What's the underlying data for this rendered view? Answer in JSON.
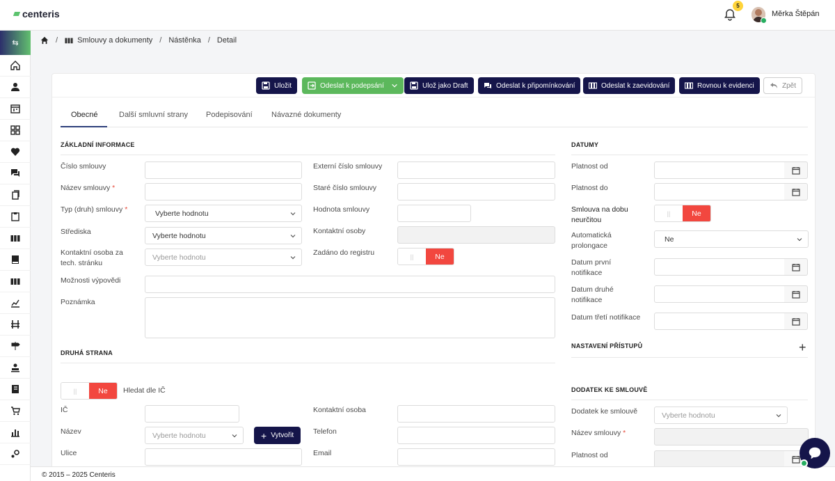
{
  "app": {
    "logo": "centeris",
    "notification_count": "5",
    "user_name": "Měrka Štěpán"
  },
  "breadcrumb": [
    "Smlouvy a dokumenty",
    "Nástěnka",
    "Detail"
  ],
  "toolbar": {
    "save": "Uložit",
    "send_sign": "Odeslat k podepsání",
    "save_draft": "Ulož jako Draft",
    "send_comment": "Odeslat k připomínkování",
    "send_register": "Odeslat k zaevidování",
    "direct_register": "Rovnou k evidenci",
    "back": "Zpět"
  },
  "tabs": [
    "Obecné",
    "Další smluvní strany",
    "Podepisování",
    "Návazné dokumenty"
  ],
  "basic": {
    "title": "ZÁKLADNÍ INFORMACE",
    "contract_no": "Číslo smlouvy",
    "contract_name": "Název smlouvy",
    "contract_type": "Typ (druh) smlouvy",
    "contract_type_value": "Vyberte hodnotu",
    "centers": "Střediska",
    "centers_value": "Vyberte hodnotu",
    "tech_contact": "Kontaktní osoba za tech. stránku",
    "tech_contact_ph": "Vyberte hodnotu",
    "termination": "Možnosti výpovědi",
    "note": "Poznámka",
    "external_no": "Externí číslo smlouvy",
    "old_no": "Staré číslo smlouvy",
    "value": "Hodnota smlouvy",
    "contacts": "Kontaktní osoby",
    "registry": "Zadáno do registru",
    "registry_value": "Ne",
    "toggle_off": "||"
  },
  "second": {
    "title": "DRUHÁ STRANA",
    "toggle_value": "Ne",
    "search_by_ic": "Hledat dle IČ",
    "ic": "IČ",
    "name": "Název",
    "name_ph": "Vyberte hodnotu",
    "create": "Vytvořit",
    "street": "Ulice",
    "contact_person": "Kontaktní osoba",
    "phone": "Telefon",
    "email": "Email"
  },
  "dates": {
    "title": "DATUMY",
    "valid_from": "Platnost od",
    "valid_to": "Platnost do",
    "indefinite": "Smlouva na dobu neurčitou",
    "indefinite_value": "Ne",
    "auto_prolong": "Automatická prolongace",
    "auto_prolong_value": "Ne",
    "first_notif": "Datum první notifikace",
    "second_notif": "Datum druhé notifikace",
    "third_notif": "Datum třetí notifikace"
  },
  "access": {
    "title": "NASTAVENÍ PŘÍSTUPŮ"
  },
  "amendment": {
    "title": "DODATEK KE SMLOUVĚ",
    "amendment_label": "Dodatek ke smlouvě",
    "amendment_ph": "Vyberte hodnotu",
    "name": "Název smlouvy",
    "valid_from": "Platnost od"
  },
  "footer": "© 2015 – 2025 Centeris",
  "colors": {
    "navy": "#15154a",
    "green": "#5cb85c",
    "red": "#f2473f"
  }
}
